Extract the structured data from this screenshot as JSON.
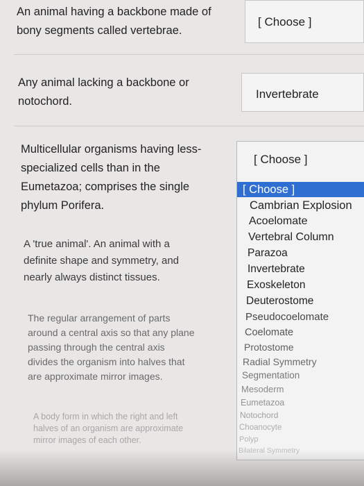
{
  "questions": [
    {
      "lines": [
        "An animal having a backbone made of",
        "bony segments called vertebrae."
      ],
      "answer": "[ Choose ]"
    },
    {
      "lines": [
        "Any animal lacking a backbone or",
        "notochord."
      ],
      "answer": "Invertebrate"
    },
    {
      "lines": [
        "Multicellular organisms having less-",
        "specialized cells than in the",
        "Eumetazoa; comprises the single",
        "phylum Porifera."
      ],
      "answer": "[ Choose ]"
    },
    {
      "lines": [
        "A 'true animal'. An animal with a",
        "definite shape and symmetry, and",
        "nearly always distinct tissues."
      ]
    },
    {
      "lines": [
        "The regular arrangement of parts",
        "around a central axis so that any plane",
        "passing through the central axis",
        "divides the organism into halves that",
        "are approximate mirror images."
      ]
    },
    {
      "lines": [
        "A body form in which the right and left",
        "halves of an organism are approximate",
        "mirror images of each other."
      ]
    }
  ],
  "dropdown": {
    "header": "[ Choose ]",
    "options": [
      "[ Choose ]",
      "Cambrian Explosion",
      "Acoelomate",
      "Vertebral Column",
      "Parazoa",
      "Invertebrate",
      "Exoskeleton",
      "Deuterostome",
      "Pseudocoelomate",
      "Coelomate",
      "Protostome",
      "Radial Symmetry",
      "Segmentation",
      "Mesoderm",
      "Eumetazoa",
      "Notochord",
      "Choanocyte",
      "Polyp",
      "Bilateral Symmetry"
    ],
    "selected": "[ Choose ]"
  },
  "colors": {
    "highlight": "#2f6fd1",
    "background": "#e9e6e6"
  }
}
